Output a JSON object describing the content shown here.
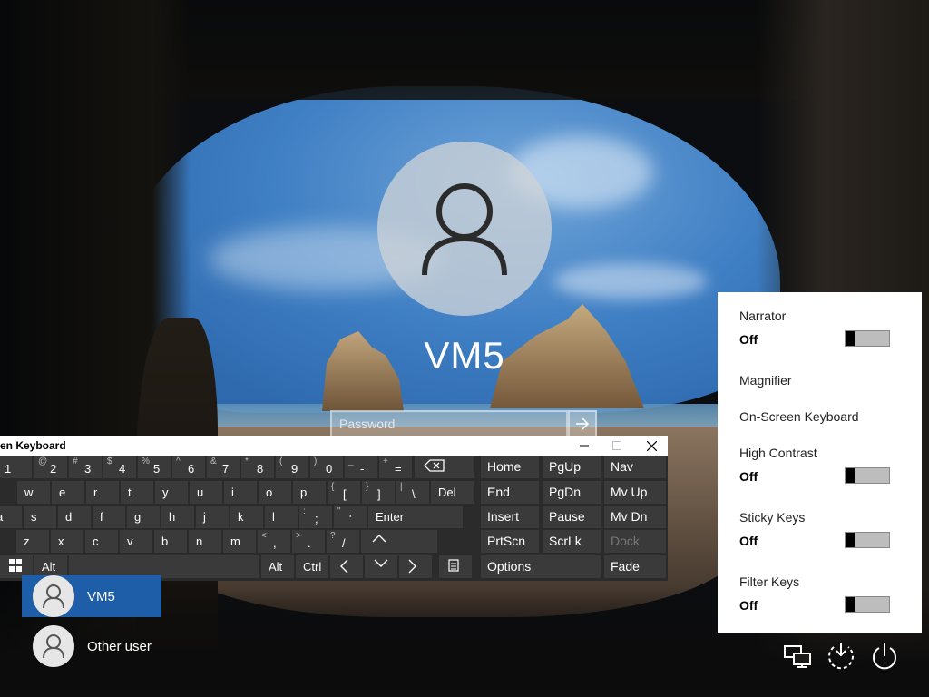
{
  "login": {
    "username": "VM5",
    "password_placeholder": "Password"
  },
  "osk": {
    "title": "en Keyboard",
    "rows": [
      [
        {
          "sub": "!",
          "main": "1"
        },
        {
          "sub": "@",
          "main": "2"
        },
        {
          "sub": "#",
          "main": "3"
        },
        {
          "sub": "$",
          "main": "4"
        },
        {
          "sub": "%",
          "main": "5"
        },
        {
          "sub": "^",
          "main": "6"
        },
        {
          "sub": "&",
          "main": "7"
        },
        {
          "sub": "*",
          "main": "8"
        },
        {
          "sub": "(",
          "main": "9"
        },
        {
          "sub": ")",
          "main": "0"
        },
        {
          "sub": "_",
          "main": "-"
        },
        {
          "sub": "+",
          "main": "="
        }
      ],
      [
        {
          "label": "w"
        },
        {
          "label": "e"
        },
        {
          "label": "r"
        },
        {
          "label": "t"
        },
        {
          "label": "y"
        },
        {
          "label": "u"
        },
        {
          "label": "i"
        },
        {
          "label": "o"
        },
        {
          "label": "p"
        },
        {
          "sub": "{",
          "main": "["
        },
        {
          "sub": "}",
          "main": "]"
        },
        {
          "sub": "|",
          "main": "\\"
        },
        {
          "label": "Del"
        }
      ],
      [
        {
          "label": "a"
        },
        {
          "label": "s"
        },
        {
          "label": "d"
        },
        {
          "label": "f"
        },
        {
          "label": "g"
        },
        {
          "label": "h"
        },
        {
          "label": "j"
        },
        {
          "label": "k"
        },
        {
          "label": "l"
        },
        {
          "sub": ":",
          "main": ";"
        },
        {
          "sub": "\"",
          "main": "'"
        },
        {
          "label": "Enter"
        }
      ],
      [
        {
          "label": "z"
        },
        {
          "label": "x"
        },
        {
          "label": "c"
        },
        {
          "label": "v"
        },
        {
          "label": "b"
        },
        {
          "label": "n"
        },
        {
          "label": "m"
        },
        {
          "sub": "<",
          "main": ","
        },
        {
          "sub": ">",
          "main": "."
        },
        {
          "sub": "?",
          "main": "/"
        },
        {
          "label": "Shift"
        }
      ],
      [
        {
          "label": "Alt"
        },
        {
          "label": ""
        },
        {
          "label": "Alt"
        },
        {
          "label": "Ctrl"
        }
      ]
    ],
    "nav_keys": [
      [
        "Home",
        "PgUp",
        "Nav"
      ],
      [
        "End",
        "PgDn",
        "Mv Up"
      ],
      [
        "Insert",
        "Pause",
        "Mv Dn"
      ],
      [
        "PrtScn",
        "ScrLk",
        "Dock"
      ]
    ],
    "options_label": "Options",
    "fade_label": "Fade"
  },
  "ease": {
    "items": [
      {
        "title": "Narrator",
        "state": "Off",
        "toggle": true
      },
      {
        "title": "Magnifier",
        "state": "",
        "toggle": false
      },
      {
        "title": "On-Screen Keyboard",
        "state": "",
        "toggle": false
      },
      {
        "title": "High Contrast",
        "state": "Off",
        "toggle": true
      },
      {
        "title": "Sticky Keys",
        "state": "Off",
        "toggle": true
      },
      {
        "title": "Filter Keys",
        "state": "Off",
        "toggle": true
      }
    ]
  },
  "users": [
    {
      "name": "VM5",
      "selected": true
    },
    {
      "name": "Other user",
      "selected": false
    }
  ],
  "icons": {
    "network": "network-icon",
    "ease_of_access": "ease-of-access-icon",
    "power": "power-icon"
  },
  "colors": {
    "selected_user": "#1e5ea8",
    "keyboard_bg": "#2b2b2b",
    "key_bg": "#3a3a3a"
  }
}
